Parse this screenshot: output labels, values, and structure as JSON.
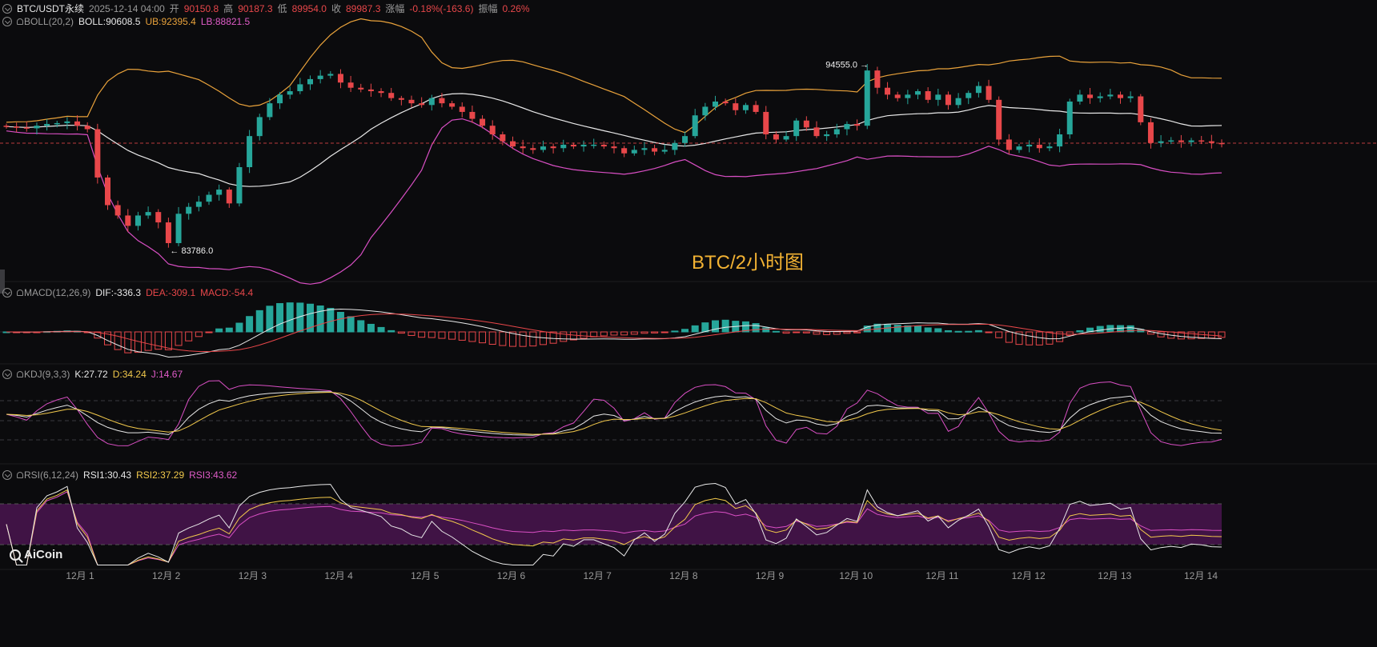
{
  "header": {
    "symbol": "BTC/USDT永续",
    "datetime": "2025-12-14 04:00",
    "open_label": "开",
    "open": "90150.8",
    "high_label": "高",
    "high": "90187.3",
    "low_label": "低",
    "low": "89954.0",
    "close_label": "收",
    "close": "89987.3",
    "change_label": "涨幅",
    "change": "-0.18%(-163.6)",
    "amplitude_label": "振幅",
    "amplitude": "0.26%"
  },
  "boll": {
    "name": "BOLL(20,2)",
    "mid": "BOLL:90608.5",
    "ub": "UB:92395.4",
    "lb": "LB:88821.5"
  },
  "macd": {
    "name": "MACD(12,26,9)",
    "dif": "DIF:-336.3",
    "dea": "DEA:-309.1",
    "macd": "MACD:-54.4"
  },
  "kdj": {
    "name": "KDJ(9,3,3)",
    "k": "K:27.72",
    "d": "D:34.24",
    "j": "J:14.67"
  },
  "rsi": {
    "name": "RSI(6,12,24)",
    "rsi1": "RSI1:30.43",
    "rsi2": "RSI2:37.29",
    "rsi3": "RSI3:43.62"
  },
  "watermark": "BTC/2小时图",
  "logo": "AiCoin",
  "colors": {
    "up": "#26a69a",
    "down": "#e8474a",
    "mid": "#e8e8e8",
    "ub": "#e9a23b",
    "lb": "#d94fc4",
    "rsi_band": "#4a1550"
  },
  "chart_data": {
    "type": "candlestick",
    "timeframe": "2h",
    "x_ticks": [
      "12月 1",
      "12月 2",
      "12月 3",
      "12月 4",
      "12月 5",
      "12月 6",
      "12月 7",
      "12月 8",
      "12月 9",
      "12月 10",
      "12月 11",
      "12月 12",
      "12月 13",
      "12月 14"
    ],
    "annotations": [
      {
        "label": "94555.0",
        "type": "high"
      },
      {
        "label": "83786.0",
        "type": "low"
      }
    ],
    "last_close": 89987.3,
    "close_series": [
      90950,
      90900,
      90850,
      91000,
      91100,
      91150,
      91250,
      91000,
      90800,
      88000,
      86400,
      85800,
      85200,
      85800,
      86000,
      85400,
      84200,
      85900,
      86300,
      86600,
      87000,
      87300,
      86500,
      88600,
      90400,
      91500,
      92300,
      92800,
      93000,
      93400,
      93700,
      93900,
      94000,
      93500,
      93200,
      93100,
      93000,
      92900,
      92600,
      92500,
      92300,
      92200,
      92600,
      92300,
      92100,
      91800,
      91400,
      91000,
      90500,
      90100,
      89800,
      89700,
      89600,
      89800,
      89700,
      89900,
      89800,
      89900,
      89900,
      89800,
      89700,
      89400,
      89600,
      89700,
      89500,
      89600,
      90000,
      90400,
      91600,
      92100,
      92400,
      92300,
      91900,
      92200,
      91800,
      90500,
      90200,
      90400,
      91300,
      90900,
      90400,
      90500,
      90800,
      91100,
      91000,
      94200,
      93200,
      92800,
      92600,
      92800,
      93000,
      92500,
      92800,
      92200,
      92600,
      92900,
      93300,
      92500,
      90200,
      89600,
      89800,
      89900,
      89700,
      89800,
      90500,
      92400,
      92800,
      92600,
      92700,
      92800,
      92600,
      92700,
      91200,
      90000,
      90100,
      90150,
      90050,
      90150,
      90100,
      90000,
      89987
    ]
  }
}
